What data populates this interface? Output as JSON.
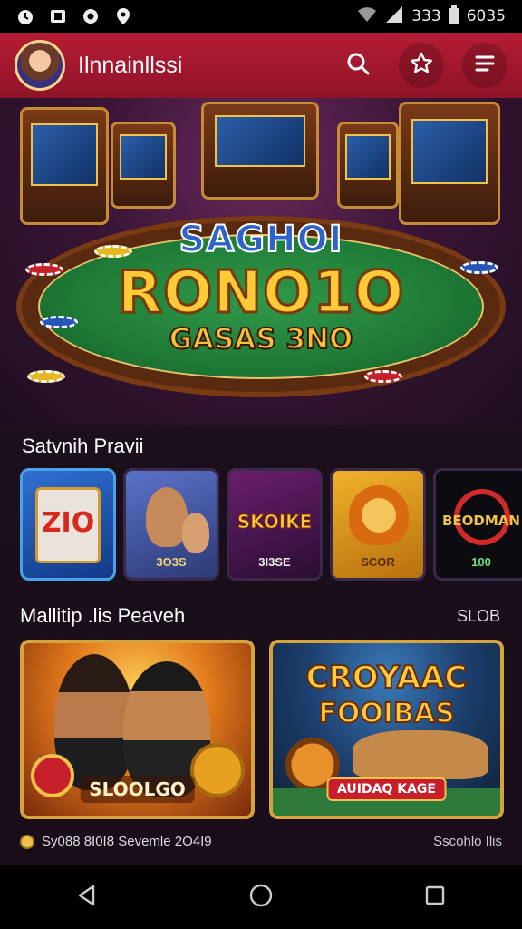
{
  "status_bar": {
    "signal_text": "333",
    "time": "6035"
  },
  "app_bar": {
    "title": "Ilnnainllssi"
  },
  "hero": {
    "line1": "SAGHOI",
    "line2": "RONO1O",
    "line3": "GASAS 3NO"
  },
  "section_featured": {
    "title": "Satvnih Pravii",
    "games": [
      {
        "title": "ZIO",
        "sub": "",
        "selected": true
      },
      {
        "title": "",
        "sub": "3O3S",
        "selected": false
      },
      {
        "title": "SKOIKE",
        "sub": "3I3SE",
        "selected": false
      },
      {
        "title": "",
        "sub": "SCOR",
        "selected": false
      },
      {
        "title": "BEODMAN",
        "sub": "100",
        "selected": false
      }
    ]
  },
  "section_promos": {
    "title": "Mallitip .lis Peaveh",
    "link": "SLOB",
    "cards": [
      {
        "label": "SLOOLGO"
      },
      {
        "headline_1": "CROYAAC",
        "headline_2": "FOOIBAS",
        "label": "AUIDAQ KAGE"
      }
    ]
  },
  "footer": {
    "left_text": "Sy088 8I0I8 Sevemle 2O4I9",
    "right_text": "Sscohlo Ilis"
  },
  "colors": {
    "appbar": "#b51c34",
    "accent_gold": "#f0c14b",
    "felt": "#1f7a36"
  },
  "icons": [
    "alarm-icon",
    "photo-icon",
    "record-icon",
    "location-icon",
    "wifi-icon",
    "signal-icon",
    "battery-icon",
    "search-icon",
    "star-icon",
    "menu-icon",
    "back-icon",
    "home-icon",
    "recents-icon"
  ]
}
